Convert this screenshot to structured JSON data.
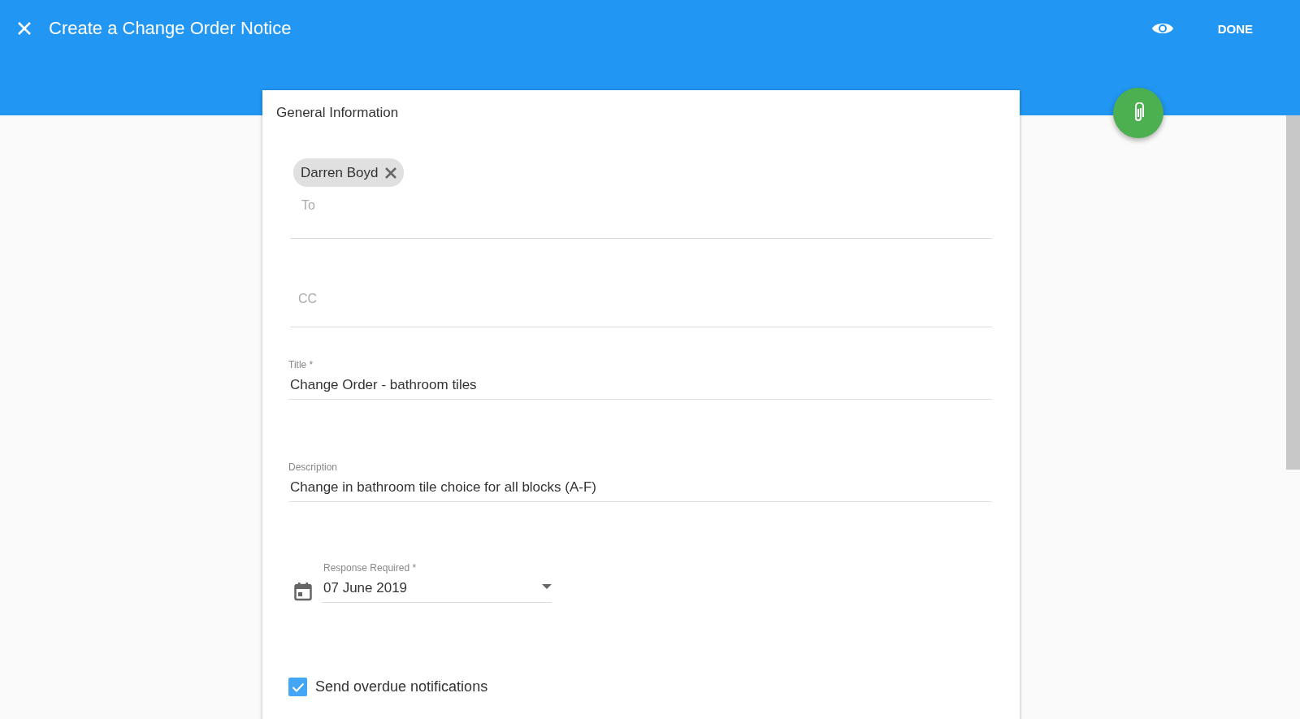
{
  "header": {
    "title": "Create a Change Order Notice",
    "done_label": "DONE"
  },
  "card": {
    "heading": "General Information",
    "to": {
      "recipients": [
        {
          "name": "Darren Boyd"
        }
      ],
      "placeholder": "To"
    },
    "cc": {
      "placeholder": "CC"
    },
    "title_field": {
      "label": "Title *",
      "value": "Change Order - bathroom tiles"
    },
    "description_field": {
      "label": "Description",
      "value": "Change in bathroom tile choice for all blocks (A-F)"
    },
    "response_field": {
      "label": "Response Required *",
      "value": "07 June 2019"
    },
    "overdue": {
      "label": "Send overdue notifications",
      "checked": true
    }
  }
}
